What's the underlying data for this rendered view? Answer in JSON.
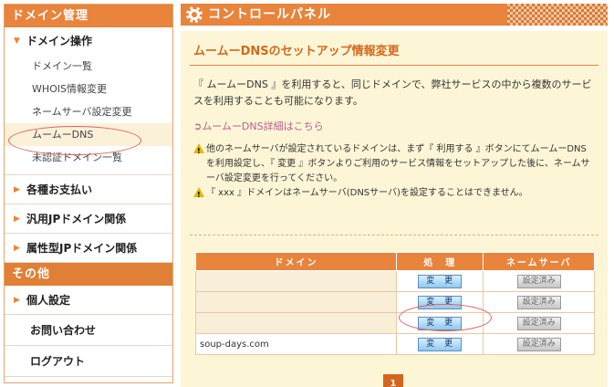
{
  "sidebar": {
    "header_domain": "ドメイン管理",
    "domain_ops": {
      "label": "ドメイン操作",
      "items": [
        "ドメイン一覧",
        "WHOIS情報変更",
        "ネームサーバ設定変更",
        "ムームーDNS",
        "未認証ドメイン一覧"
      ]
    },
    "menus": [
      "各種お支払い",
      "汎用JPドメイン関係",
      "属性型JPドメイン関係"
    ],
    "header_other": "その他",
    "other_items": [
      "個人設定",
      "お問い合わせ",
      "ログアウト"
    ]
  },
  "main": {
    "title": "コントロールパネル",
    "panel_title": "ムームーDNSのセットアップ情報変更",
    "intro": "『 ムームーDNS 』を利用すると、同じドメインで、弊社サービスの中から複数のサービスを利用することも可能になります。",
    "detail_link": "ムームーDNS詳細はこちら",
    "note1": "他のネームサーバが設定されているドメインは、まず『 利用する 』ボタンにてムームーDNSを利用設定し、『 変更 』ボタンよりご利用のサービス情報をセットアップした後に、ネームサーバ設定変更を行ってください。",
    "note2": "『 xxx 』ドメインはネームサーバ(DNSサーバ)を設定することはできません。"
  },
  "table": {
    "headers": {
      "domain": "ドメイン",
      "process": "処　理",
      "nameserver": "ネームサーバ"
    },
    "change_label": "変 更",
    "set_label": "設定済み",
    "rows": [
      {
        "domain": ""
      },
      {
        "domain": ""
      },
      {
        "domain": ""
      },
      {
        "domain": "soup-days.com"
      }
    ]
  },
  "pager": {
    "current": "1"
  },
  "colors": {
    "accent": "#e8843c",
    "panel_bg": "#fdf6d6",
    "highlight": "#e06060"
  }
}
